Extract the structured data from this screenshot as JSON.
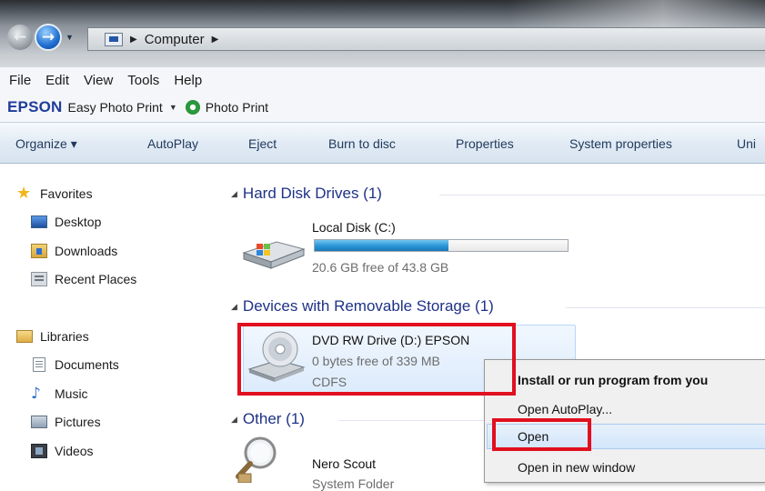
{
  "address_bar": {
    "crumbs": [
      "Computer"
    ]
  },
  "menu_bar": {
    "items": [
      "File",
      "Edit",
      "View",
      "Tools",
      "Help"
    ]
  },
  "epson_toolbar": {
    "logo": "EPSON",
    "easy_photo_print": "Easy Photo Print",
    "photo_print": "Photo Print"
  },
  "command_bar": {
    "items": [
      "Organize ▾",
      "AutoPlay",
      "Eject",
      "Burn to disc",
      "Properties",
      "System properties",
      "Uni"
    ]
  },
  "navigation_pane": {
    "favorites": {
      "label": "Favorites",
      "items": [
        "Desktop",
        "Downloads",
        "Recent Places"
      ]
    },
    "libraries": {
      "label": "Libraries",
      "items": [
        "Documents",
        "Music",
        "Pictures",
        "Videos"
      ]
    }
  },
  "content": {
    "groups": {
      "hard_disk": {
        "label": "Hard Disk Drives (1)"
      },
      "removable": {
        "label": "Devices with Removable Storage (1)"
      },
      "other": {
        "label": "Other (1)"
      }
    },
    "local_disk": {
      "name": "Local Disk (C:)",
      "free_text": "20.6 GB free of 43.8 GB",
      "used_fraction": 0.53
    },
    "dvd_drive": {
      "name": "DVD RW Drive (D:) EPSON",
      "free_text": "0 bytes free of 339 MB",
      "filesystem": "CDFS"
    },
    "nero_scout": {
      "name": "Nero Scout",
      "type": "System Folder"
    }
  },
  "context_menu": {
    "items": [
      "Install or run program from you",
      "Open AutoPlay...",
      "Open",
      "Open in new window"
    ]
  },
  "colors": {
    "highlight_red": "#e10f1f",
    "group_header_blue": "#1e3287",
    "command_text": "#1e395b",
    "epson_blue": "#1e3c9a"
  }
}
